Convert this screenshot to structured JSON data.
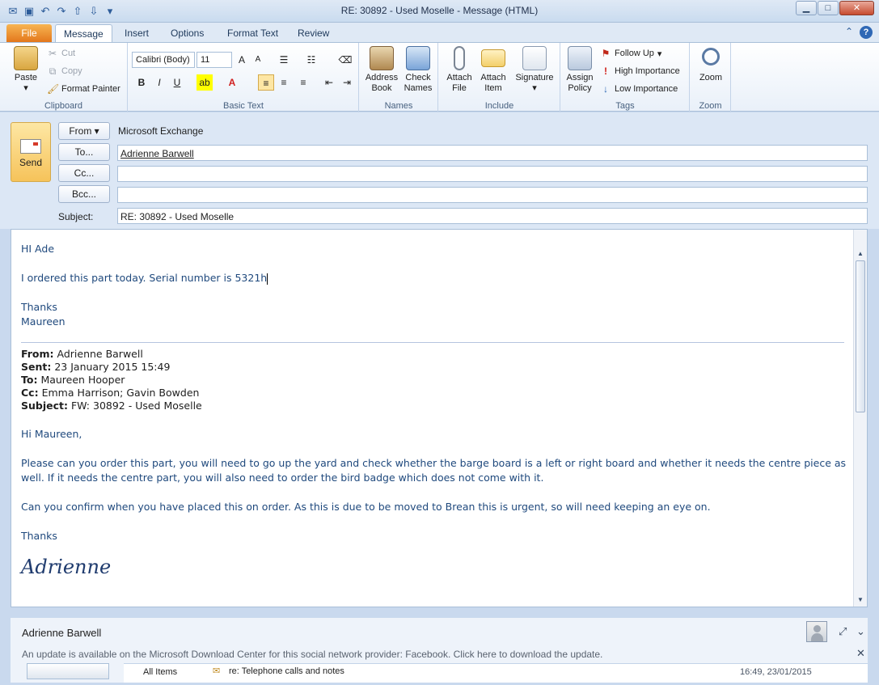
{
  "window": {
    "title": "RE: 30892 - Used Moselle  -  Message (HTML)"
  },
  "tabs": [
    {
      "label": "File"
    },
    {
      "label": "Message"
    },
    {
      "label": "Insert"
    },
    {
      "label": "Options"
    },
    {
      "label": "Format Text"
    },
    {
      "label": "Review"
    }
  ],
  "ribbon": {
    "clipboard": {
      "label": "Clipboard",
      "paste": "Paste",
      "cut": "Cut",
      "copy": "Copy",
      "format_painter": "Format Painter"
    },
    "basic_text": {
      "label": "Basic Text",
      "font": "Calibri (Body)",
      "size": "11"
    },
    "names": {
      "label": "Names",
      "address_book": "Address Book",
      "check_names": "Check Names"
    },
    "include": {
      "label": "Include",
      "attach_file": "Attach File",
      "attach_item": "Attach Item",
      "signature": "Signature"
    },
    "tags": {
      "label": "Tags",
      "assign_policy": "Assign Policy",
      "follow_up": "Follow Up",
      "high_importance": "High Importance",
      "low_importance": "Low Importance"
    },
    "zoom": {
      "label": "Zoom",
      "zoom": "Zoom"
    }
  },
  "header": {
    "send": "Send",
    "from_button": "From",
    "from_value": "Microsoft Exchange",
    "to_button": "To...",
    "to_value": "Adrienne Barwell",
    "cc_button": "Cc...",
    "cc_value": "",
    "bcc_button": "Bcc...",
    "bcc_value": "",
    "subject_label": "Subject:",
    "subject_value": "RE: 30892 - Used Moselle"
  },
  "body": {
    "greeting": "HI Ade",
    "line1": "I ordered this part today.  Serial number is 5321h",
    "thanks": "Thanks",
    "name": "Maureen",
    "quoted": {
      "from_label": "From:",
      "from": "Adrienne Barwell",
      "sent_label": "Sent:",
      "sent": "23 January 2015 15:49",
      "to_label": "To:",
      "to": "Maureen Hooper",
      "cc_label": "Cc:",
      "cc": "Emma Harrison; Gavin Bowden",
      "subject_label": "Subject:",
      "subject": "FW: 30892 - Used Moselle"
    },
    "q_greeting": "Hi Maureen,",
    "q_para1a": "Please can you order this part, you will need to go up the yard and check whether the barge board is a left or right board and whether it needs the centre piece as",
    "q_para1b": "well.  If it needs the centre part, you will also need to order the bird badge which does not come with it.",
    "q_para2": "Can you confirm when you have placed this on order.    As this is due to be moved to Brean this is urgent, so will need keeping an eye on.",
    "q_thanks": "Thanks",
    "q_signature": "Adrienne"
  },
  "people_pane": {
    "name": "Adrienne Barwell",
    "update_msg": "An update is available on the Microsoft Download Center for this social network provider: Facebook. Click here to download the update.",
    "feed_filter": "All Items",
    "feed_item": "re: Telephone calls and notes",
    "feed_time": "16:49, 23/01/2015"
  }
}
